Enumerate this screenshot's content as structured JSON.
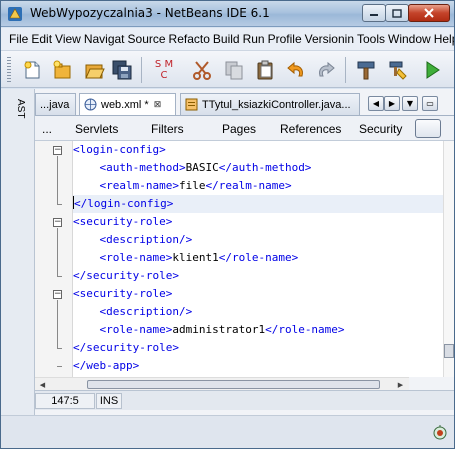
{
  "window": {
    "title": "WebWypozyczalnia3 - NetBeans IDE 6.1"
  },
  "menu": [
    "File",
    "Edit",
    "View",
    "Navigat",
    "Source",
    "Refacto",
    "Build",
    "Run",
    "Profile",
    "Versionin",
    "Tools",
    "Window",
    "Help"
  ],
  "toolbar": {
    "buttons": [
      "new-file-icon",
      "new-project-icon",
      "open-project-icon",
      "save-all-icon",
      "smc-icon",
      "cut-icon",
      "copy-icon",
      "paste-icon",
      "undo-icon",
      "redo-icon",
      "build-icon",
      "clean-build-icon",
      "run-icon"
    ],
    "smc_label_top": "S M",
    "smc_label_bottom": "C"
  },
  "side_panel": {
    "label": "AST"
  },
  "editor_tabs": [
    {
      "label": "...java",
      "active": false
    },
    {
      "label": "web.xml *",
      "active": true
    },
    {
      "label": "TTytul_ksiazkiController.java...",
      "active": false
    }
  ],
  "tab_close": "⊠",
  "view_tabs": [
    "...",
    "Servlets",
    "Filters",
    "Pages",
    "References",
    "Security"
  ],
  "code": {
    "lines": [
      {
        "indent": "",
        "open": "<login-config>",
        "text": "",
        "close": ""
      },
      {
        "indent": "    ",
        "open": "<auth-method>",
        "text": "BASIC",
        "close": "</auth-method>"
      },
      {
        "indent": "    ",
        "open": "<realm-name>",
        "text": "file",
        "close": "</realm-name>"
      },
      {
        "indent": "",
        "open": "</login-config>",
        "text": "",
        "close": ""
      },
      {
        "indent": "",
        "open": "<security-role>",
        "text": "",
        "close": ""
      },
      {
        "indent": "    ",
        "open": "<description/>",
        "text": "",
        "close": ""
      },
      {
        "indent": "    ",
        "open": "<role-name>",
        "text": "klient1",
        "close": "</role-name>"
      },
      {
        "indent": "",
        "open": "</security-role>",
        "text": "",
        "close": ""
      },
      {
        "indent": "",
        "open": "<security-role>",
        "text": "",
        "close": ""
      },
      {
        "indent": "    ",
        "open": "<description/>",
        "text": "",
        "close": ""
      },
      {
        "indent": "    ",
        "open": "<role-name>",
        "text": "administrator1",
        "close": "</role-name>"
      },
      {
        "indent": "",
        "open": "</security-role>",
        "text": "",
        "close": ""
      },
      {
        "indent": "",
        "open": "</web-app>",
        "text": "",
        "close": ""
      }
    ],
    "current_line": 3
  },
  "status": {
    "position": "147:5",
    "mode": "INS"
  },
  "colors": {
    "tag": "#0000e6",
    "text": "#000000",
    "current_line": "#e9eff8"
  }
}
